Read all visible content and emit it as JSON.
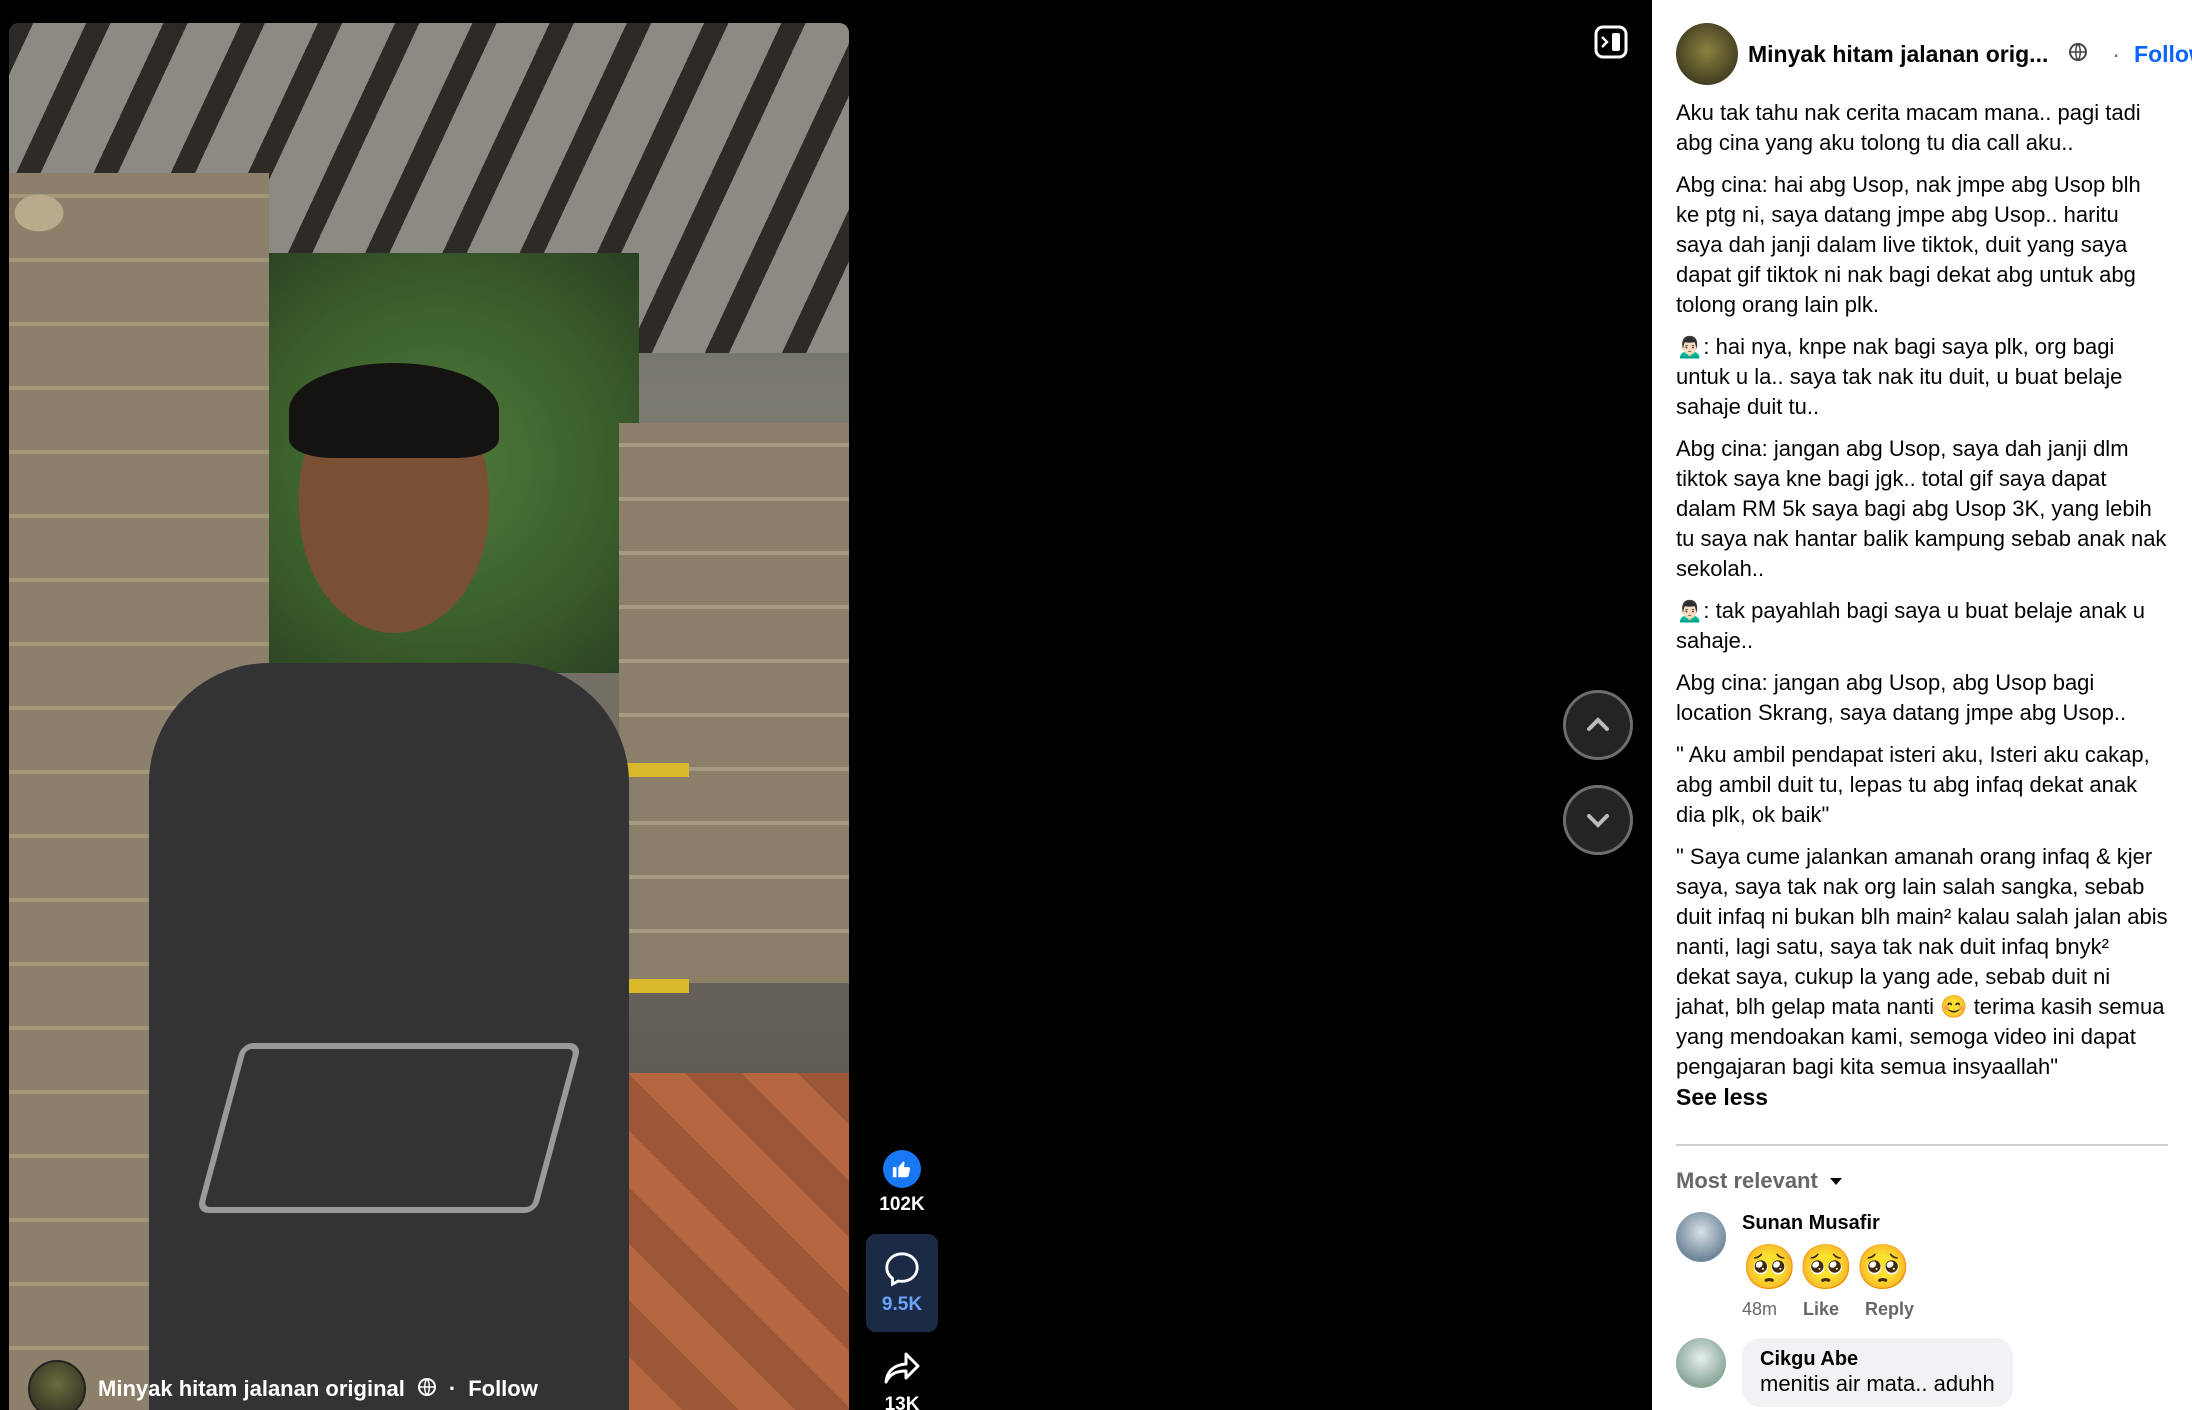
{
  "video": {
    "author_name": "Minyak hitam jalanan original",
    "follow_label": "Follow",
    "dot": "·"
  },
  "actions": {
    "likes": "102K",
    "comments": "9.5K",
    "shares": "13K"
  },
  "post": {
    "page_name": "Minyak hitam jalanan orig...",
    "dot": "·",
    "follow_label": "Follow",
    "paragraphs": [
      "Aku tak tahu nak cerita macam mana.. pagi tadi abg cina yang aku tolong tu dia call aku..",
      "Abg cina: hai abg Usop, nak jmpe abg Usop blh ke ptg ni, saya datang jmpe abg Usop.. haritu saya dah janji dalam live tiktok, duit yang saya dapat gif tiktok ni nak bagi dekat abg untuk abg tolong orang lain plk.",
      "🙍🏻‍♂️: hai nya, knpe nak bagi saya plk, org bagi untuk u la.. saya tak nak itu duit, u buat belaje sahaje duit tu..",
      "Abg cina: jangan abg Usop, saya dah janji dlm tiktok saya kne bagi jgk.. total gif saya dapat dalam RM 5k saya bagi abg Usop 3K, yang lebih tu saya nak hantar balik kampung sebab anak nak sekolah..",
      "🙍🏻‍♂️: tak payahlah bagi saya u buat belaje anak u sahaje..",
      "Abg cina: jangan abg Usop, abg Usop bagi location Skrang, saya datang jmpe abg Usop..",
      "\" Aku ambil pendapat isteri aku, Isteri aku cakap, abg ambil duit tu, lepas tu abg infaq dekat anak dia plk, ok baik\"",
      "\" Saya cume jalankan amanah orang infaq & kjer saya, saya tak nak org lain salah sangka, sebab duit infaq ni bukan blh main² kalau salah jalan abis nanti, lagi satu, saya tak nak duit infaq bnyk² dekat saya, cukup la yang ade, sebab duit ni jahat, blh gelap mata nanti 😊 terima kasih semua yang mendoakan kami, semoga video ini dapat pengajaran bagi kita semua insyaallah\""
    ],
    "see_less": "See less"
  },
  "comments": {
    "sort_label": "Most relevant",
    "items": [
      {
        "name": "Sunan Musafir",
        "text": "🥺🥺🥺",
        "time": "48m",
        "like": "Like",
        "reply": "Reply"
      },
      {
        "name": "Cikgu Abe",
        "text": "menitis air mata.. aduhh"
      }
    ]
  },
  "icons": {
    "like": "thumbs-up-icon",
    "comment": "comment-bubble-icon",
    "share": "share-arrow-icon",
    "up": "chevron-up-icon",
    "down": "chevron-down-icon",
    "mini": "miniplayer-icon",
    "globe": "globe-icon"
  },
  "colors": {
    "accent": "#0866ff",
    "like_blue": "#1877f2"
  }
}
